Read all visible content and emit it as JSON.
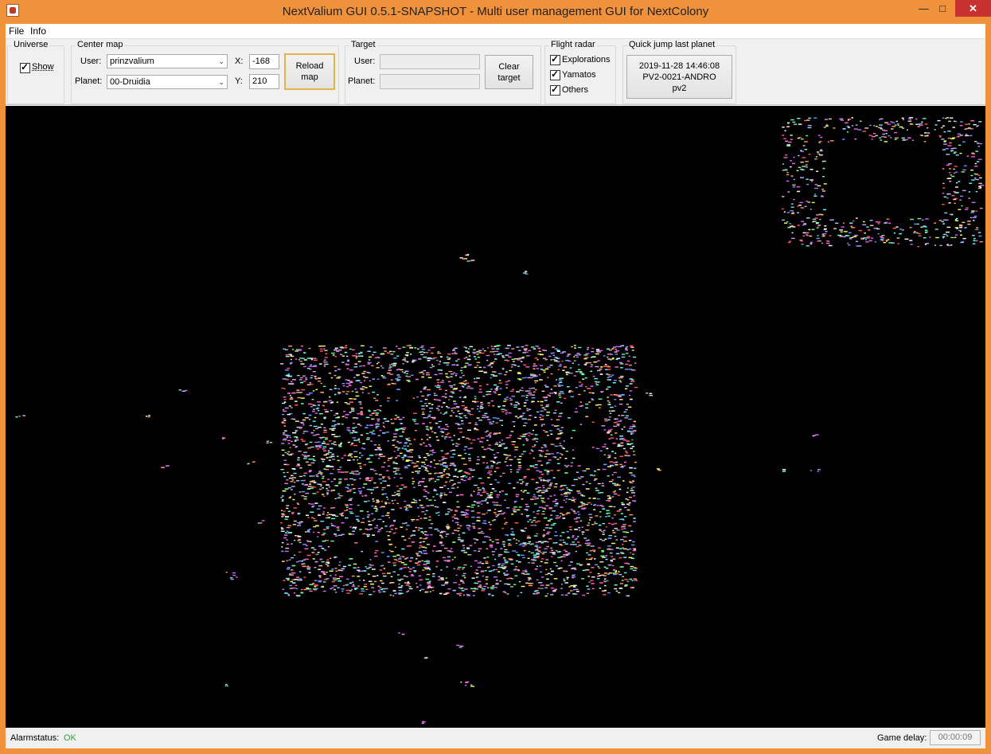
{
  "window": {
    "title": "NextValium GUI 0.5.1-SNAPSHOT - Multi user management GUI for NextColony",
    "minimize": "—",
    "maximize": "□",
    "close": "✕",
    "app_icon": "java-cup-icon"
  },
  "menu": {
    "file": "File",
    "info": "Info"
  },
  "universe": {
    "title": "Universe",
    "show_label": "Show",
    "show_checked": true
  },
  "center_map": {
    "title": "Center map",
    "user_label": "User:",
    "user_value": "prinzvalium",
    "planet_label": "Planet:",
    "planet_value": "00-Druidia",
    "x_label": "X:",
    "x_value": "-168",
    "y_label": "Y:",
    "y_value": "210",
    "reload_line1": "Reload",
    "reload_line2": "map"
  },
  "target": {
    "title": "Target",
    "user_label": "User:",
    "user_value": "",
    "planet_label": "Planet:",
    "planet_value": "",
    "clear_line1": "Clear",
    "clear_line2": "target"
  },
  "flight_radar": {
    "title": "Flight radar",
    "items": [
      {
        "label": "Explorations",
        "checked": true
      },
      {
        "label": "Yamatos",
        "checked": true
      },
      {
        "label": "Others",
        "checked": true
      }
    ]
  },
  "quick_jump": {
    "title": "Quick jump last planet",
    "line1": "2019-11-28 14:46:08",
    "line2": "PV2-0021-ANDRO",
    "line3": "pv2"
  },
  "status": {
    "alarm_label": "Alarmstatus:",
    "alarm_value": "OK",
    "alarm_color": "#2ea62e",
    "delay_label": "Game delay:",
    "delay_value": "00:00:09"
  },
  "map": {
    "background": "#000000",
    "point_colors": [
      "#ffffff",
      "#ff66cc",
      "#6699ff",
      "#ffff66",
      "#66ff99",
      "#cc66ff",
      "#ff9966",
      "#66ffff",
      "#ff5555",
      "#99ccff",
      "#ffcc99",
      "#cc99ff"
    ]
  }
}
